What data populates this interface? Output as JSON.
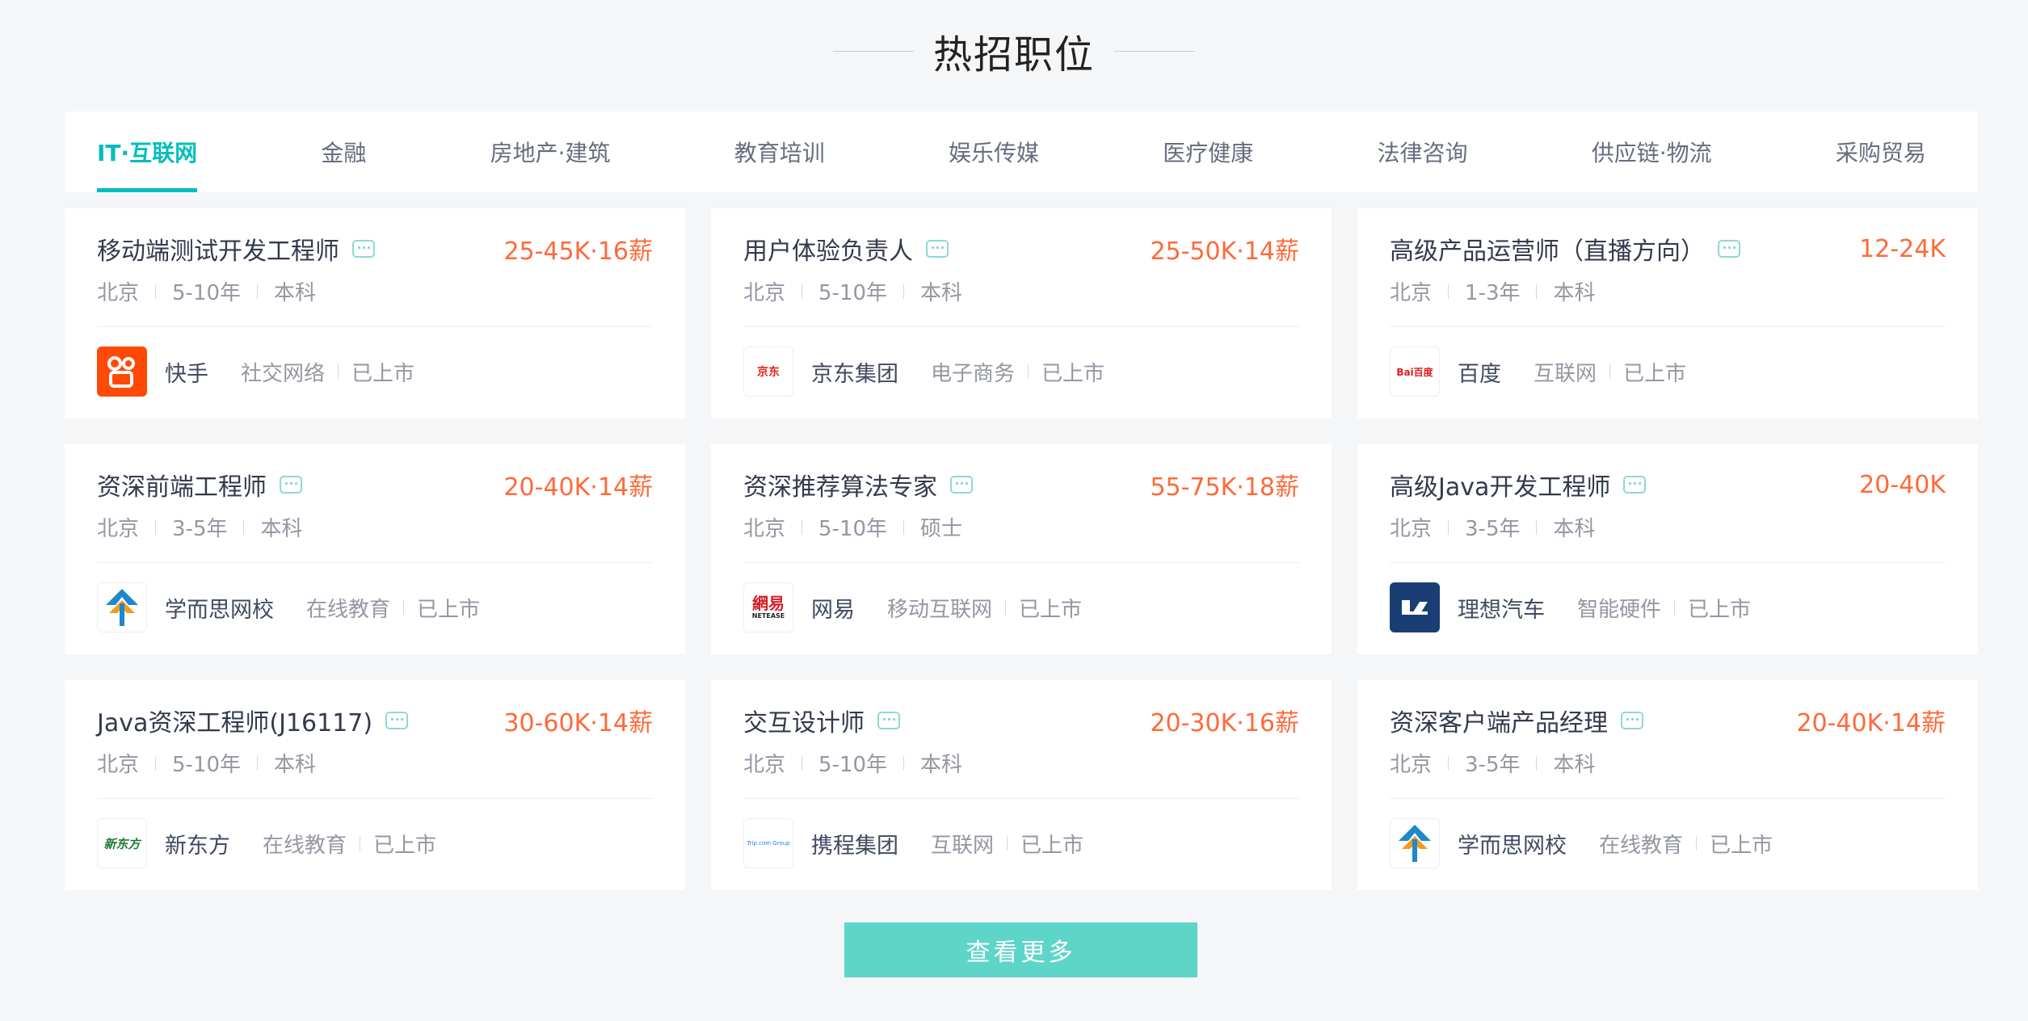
{
  "section": {
    "title": "热招职位"
  },
  "tabs": [
    {
      "label": "IT·互联网",
      "active": true
    },
    {
      "label": "金融"
    },
    {
      "label": "房地产·建筑"
    },
    {
      "label": "教育培训"
    },
    {
      "label": "娱乐传媒"
    },
    {
      "label": "医疗健康"
    },
    {
      "label": "法律咨询"
    },
    {
      "label": "供应链·物流"
    },
    {
      "label": "采购贸易"
    }
  ],
  "jobs": [
    {
      "title": "移动端测试开发工程师",
      "salary": "25-45K·16薪",
      "city": "北京",
      "experience": "5-10年",
      "degree": "本科",
      "company": "快手",
      "industry": "社交网络",
      "stage": "已上市",
      "logo": "kuaishou-logo"
    },
    {
      "title": "用户体验负责人",
      "salary": "25-50K·14薪",
      "city": "北京",
      "experience": "5-10年",
      "degree": "本科",
      "company": "京东集团",
      "industry": "电子商务",
      "stage": "已上市",
      "logo": "jd-logo",
      "logo_text": "京东"
    },
    {
      "title": "高级产品运营师（直播方向）",
      "salary": "12-24K",
      "city": "北京",
      "experience": "1-3年",
      "degree": "本科",
      "company": "百度",
      "industry": "互联网",
      "stage": "已上市",
      "logo": "baidu-logo",
      "logo_text": "Bai百度"
    },
    {
      "title": "资深前端工程师",
      "salary": "20-40K·14薪",
      "city": "北京",
      "experience": "3-5年",
      "degree": "本科",
      "company": "学而思网校",
      "industry": "在线教育",
      "stage": "已上市",
      "logo": "xueersi-logo"
    },
    {
      "title": "资深推荐算法专家",
      "salary": "55-75K·18薪",
      "city": "北京",
      "experience": "5-10年",
      "degree": "硕士",
      "company": "网易",
      "industry": "移动互联网",
      "stage": "已上市",
      "logo": "netease-logo",
      "logo_text": "網易",
      "logo_sub": "NETEASE"
    },
    {
      "title": "高级Java开发工程师",
      "salary": "20-40K",
      "city": "北京",
      "experience": "3-5年",
      "degree": "本科",
      "company": "理想汽车",
      "industry": "智能硬件",
      "stage": "已上市",
      "logo": "lixiang-logo"
    },
    {
      "title": "Java资深工程师(J16117)",
      "salary": "30-60K·14薪",
      "city": "北京",
      "experience": "5-10年",
      "degree": "本科",
      "company": "新东方",
      "industry": "在线教育",
      "stage": "已上市",
      "logo": "xdf-logo",
      "logo_text": "新东方"
    },
    {
      "title": "交互设计师",
      "salary": "20-30K·16薪",
      "city": "北京",
      "experience": "5-10年",
      "degree": "本科",
      "company": "携程集团",
      "industry": "互联网",
      "stage": "已上市",
      "logo": "trip-logo",
      "logo_text": "Trip.com Group"
    },
    {
      "title": "资深客户端产品经理",
      "salary": "20-40K·14薪",
      "city": "北京",
      "experience": "3-5年",
      "degree": "本科",
      "company": "学而思网校",
      "industry": "在线教育",
      "stage": "已上市",
      "logo": "xueersi-logo"
    }
  ],
  "more_button": {
    "label": "查看更多"
  },
  "colors": {
    "accent": "#00bebd",
    "salary": "#fe6a3a",
    "button": "#5dd5c8"
  }
}
